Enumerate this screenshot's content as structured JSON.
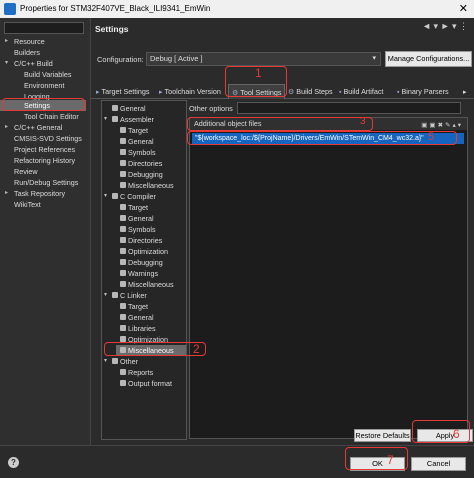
{
  "window": {
    "title": "Properties for STM32F407VE_Black_ILI9341_EmWin"
  },
  "left_tree": {
    "filter_placeholder": "",
    "items": [
      {
        "label": "Resource"
      },
      {
        "label": "Builders"
      },
      {
        "label": "C/C++ Build"
      },
      {
        "label": "Build Variables"
      },
      {
        "label": "Environment"
      },
      {
        "label": "Logging"
      },
      {
        "label": "Settings"
      },
      {
        "label": "Tool Chain Editor"
      },
      {
        "label": "C/C++ General"
      },
      {
        "label": "CMSIS-SVD Settings"
      },
      {
        "label": "Project References"
      },
      {
        "label": "Refactoring History"
      },
      {
        "label": "Review"
      },
      {
        "label": "Run/Debug Settings"
      },
      {
        "label": "Task Repository"
      },
      {
        "label": "WikiText"
      }
    ]
  },
  "header": {
    "title": "Settings",
    "nav": "◄ ▾ ► ▾ ⋮"
  },
  "configuration": {
    "label": "Configuration:",
    "value": "Debug  [ Active ]",
    "manage_button": "Manage Configurations..."
  },
  "tabs": [
    {
      "label": "Target Settings"
    },
    {
      "label": "Toolchain Version"
    },
    {
      "label": "Tool Settings"
    },
    {
      "label": "Build Steps"
    },
    {
      "label": "Build Artifact"
    },
    {
      "label": "Binary Parsers"
    }
  ],
  "tool_tree": [
    {
      "label": "General"
    },
    {
      "label": "Assembler"
    },
    {
      "label": "Target"
    },
    {
      "label": "General"
    },
    {
      "label": "Symbols"
    },
    {
      "label": "Directories"
    },
    {
      "label": "Debugging"
    },
    {
      "label": "Miscellaneous"
    },
    {
      "label": "C Compiler"
    },
    {
      "label": "Target"
    },
    {
      "label": "General"
    },
    {
      "label": "Symbols"
    },
    {
      "label": "Directories"
    },
    {
      "label": "Optimization"
    },
    {
      "label": "Debugging"
    },
    {
      "label": "Warnings"
    },
    {
      "label": "Miscellaneous"
    },
    {
      "label": "C Linker"
    },
    {
      "label": "Target"
    },
    {
      "label": "General"
    },
    {
      "label": "Libraries"
    },
    {
      "label": "Optimization"
    },
    {
      "label": "Miscellaneous"
    },
    {
      "label": "Other"
    },
    {
      "label": "Reports"
    },
    {
      "label": "Output format"
    }
  ],
  "options": {
    "other_options_label": "Other options",
    "other_options_value": "",
    "object_files_label": "Additional object files",
    "object_files": [
      "\"${workspace_loc:/${ProjName}/Drivers/EmWin/STemWin_CM4_wc32.a}\""
    ]
  },
  "buttons": {
    "restore": "Restore Defaults",
    "apply": "Apply",
    "ok": "OK",
    "cancel": "Cancel",
    "help": "?"
  },
  "annotations": [
    "1",
    "2",
    "3",
    "4",
    "5",
    "6",
    "7"
  ],
  "colors": {
    "selection": "#1565c0",
    "annotation": "#e53935"
  }
}
